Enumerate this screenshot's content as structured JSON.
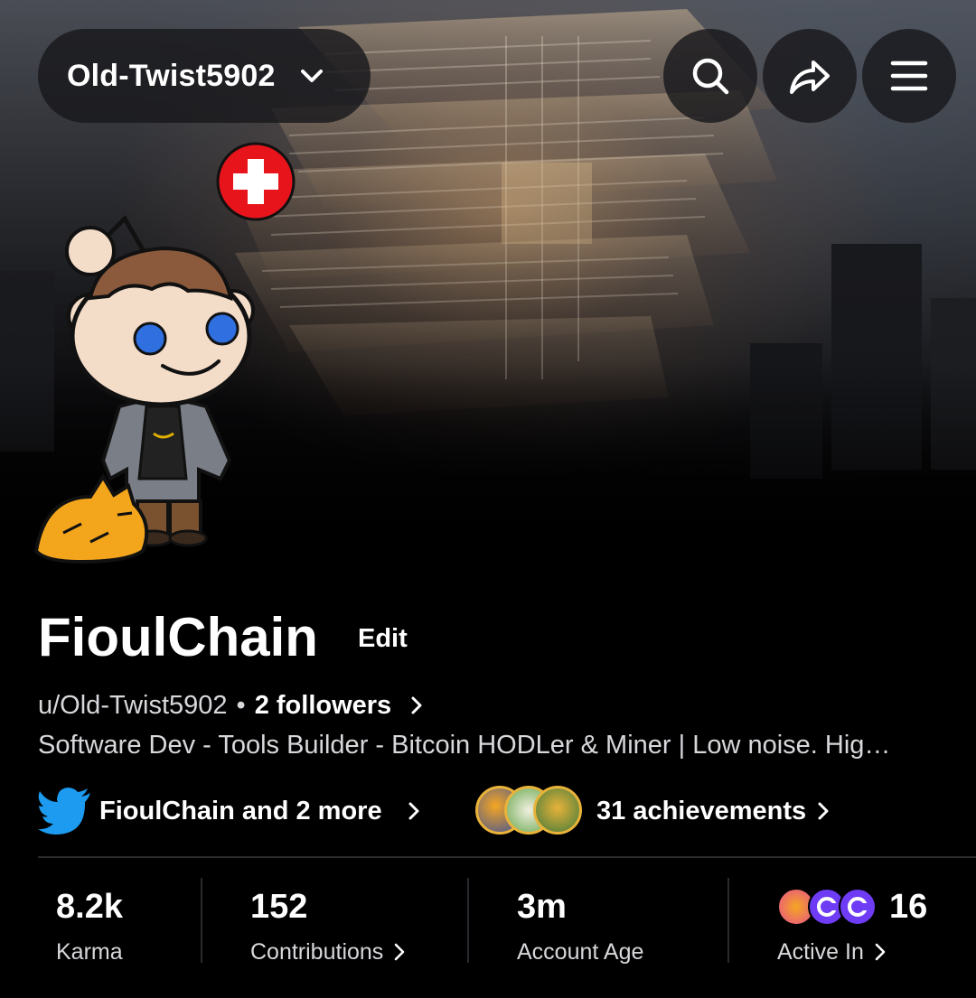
{
  "header": {
    "account_switcher_label": "Old-Twist5902",
    "icons": [
      "search-icon",
      "share-icon",
      "menu-icon"
    ]
  },
  "profile": {
    "display_name": "FioulChain",
    "edit_label": "Edit",
    "username": "u/Old-Twist5902",
    "separator": "•",
    "followers": "2 followers",
    "bio": "Software Dev - Tools Builder - Bitcoin HODLer & Miner | Low noise. Hig…",
    "social_links": "FioulChain and 2 more",
    "achievements": "31 achievements"
  },
  "stats": [
    {
      "value": "8.2k",
      "label": "Karma"
    },
    {
      "value": "152",
      "label": "Contributions"
    },
    {
      "value": "3m",
      "label": "Account Age"
    },
    {
      "value": "16",
      "label": "Active In"
    }
  ],
  "colors": {
    "background": "#000000",
    "pill_bg": "#19191c",
    "twitter_blue": "#1d9bf0",
    "badge_red": "#e8141c",
    "achievement_gold": "#e9b33a",
    "community_purple": "#6f3cf5"
  }
}
